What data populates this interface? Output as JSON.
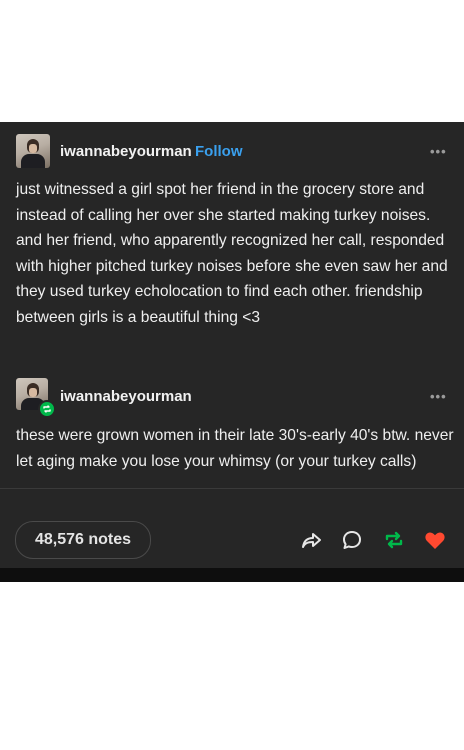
{
  "post": {
    "author": {
      "username": "iwannabeyourman",
      "follow_label": "Follow",
      "avatar_icon": "avatar-photo"
    },
    "body": "just witnessed a girl spot her friend in the grocery store and instead of calling her over she started making turkey noises. and her friend, who apparently recognized her call, responded with higher pitched turkey noises before she even saw her and they used turkey echolocation to find each other. friendship between girls is a beautiful thing <3",
    "menu_label": "•••"
  },
  "reblog": {
    "author": {
      "username": "iwannabeyourman",
      "avatar_icon": "avatar-photo",
      "badge_icon": "reblog-icon"
    },
    "body": "these were grown women in their late 30's-early 40's btw. never let aging make you lose your whimsy (or your turkey calls)",
    "menu_label": "•••"
  },
  "footer": {
    "notes_label": "48,576 notes",
    "actions": [
      {
        "name": "share",
        "icon": "share-arrow-icon"
      },
      {
        "name": "reply",
        "icon": "speech-bubble-icon"
      },
      {
        "name": "reblog",
        "icon": "reblog-icon",
        "color": "#00b84a"
      },
      {
        "name": "like",
        "icon": "heart-icon",
        "color": "#ff4930"
      }
    ]
  },
  "colors": {
    "background": "#262626",
    "follow": "#3aa0ee",
    "reblog": "#00b84a",
    "like": "#ff4930"
  }
}
